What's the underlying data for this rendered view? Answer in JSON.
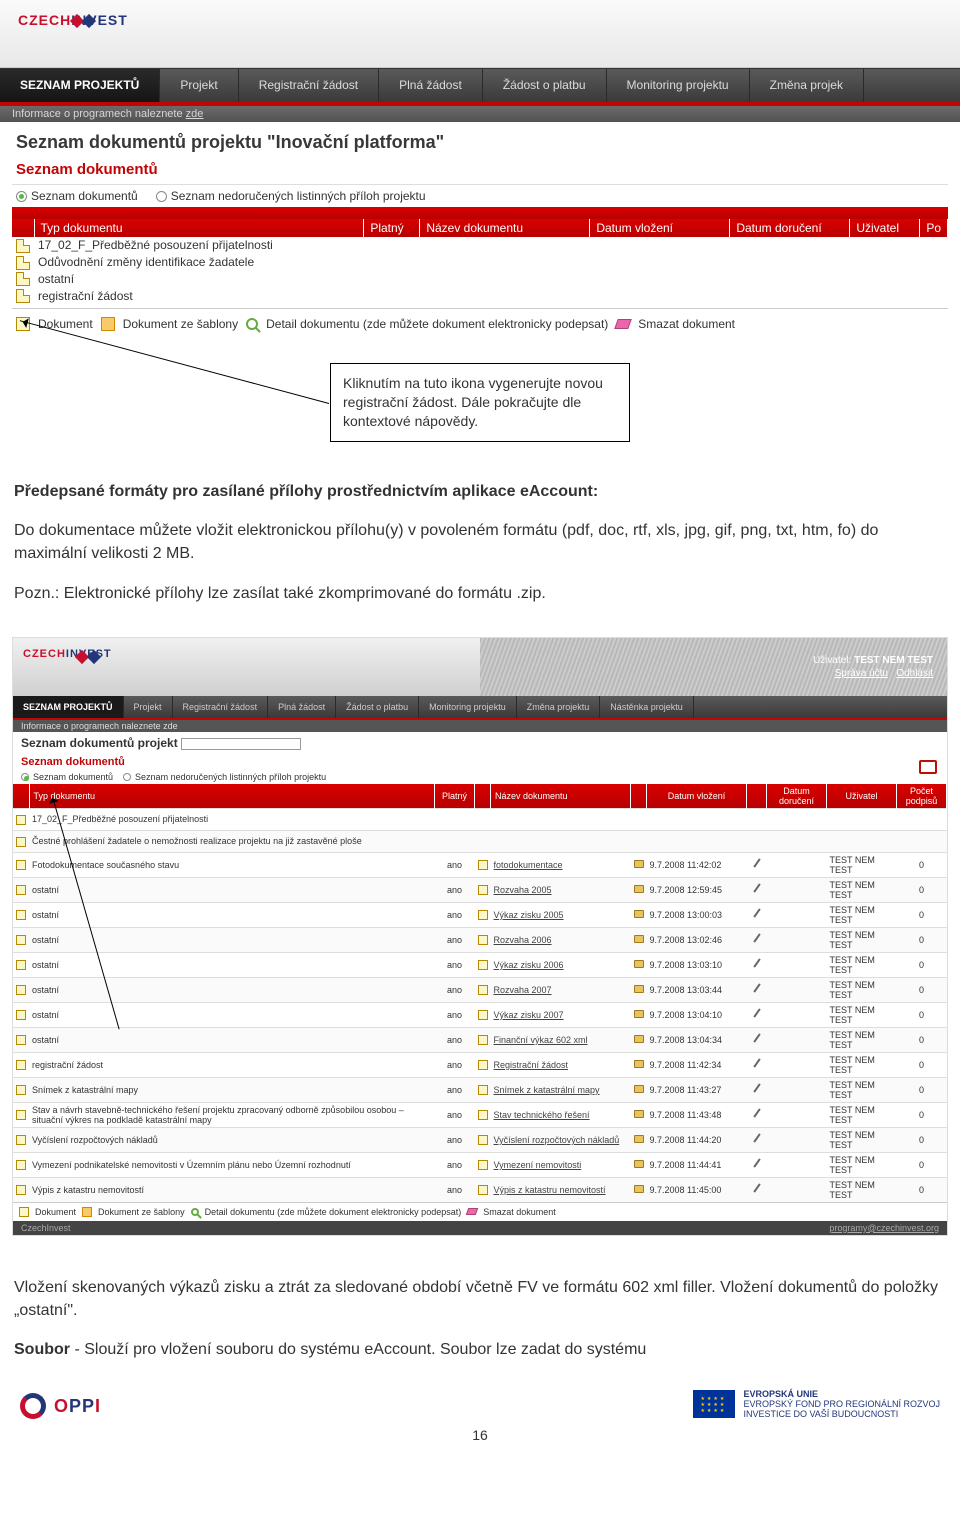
{
  "app1": {
    "brand_a": "CZECH",
    "brand_b": "INVEST",
    "menu": {
      "seznam": "SEZNAM PROJEKTŮ",
      "projekt": "Projekt",
      "registracni": "Registrační žádost",
      "plna": "Plná žádost",
      "platbu": "Žádost o platbu",
      "monitoring": "Monitoring projektu",
      "zmena": "Změna projek"
    },
    "infobar": "Informace o programech naleznete",
    "infobar_link": "zde",
    "title": "Seznam dokumentů projektu  \"Inovační platforma\"",
    "section": "Seznam dokumentů",
    "radio1": "Seznam dokumentů",
    "radio2": "Seznam nedoručených listinných příloh projektu",
    "th": {
      "typ": "Typ dokumentu",
      "platny": "Platný",
      "nazev": "Název dokumentu",
      "vlozeni": "Datum vložení",
      "doruceni": "Datum doručení",
      "uzivatel": "Uživatel",
      "po": "Po"
    },
    "rows": [
      "17_02_F_Předběžné posouzení přijatelnosti",
      "Odůvodnění změny identifikace žadatele",
      "ostatní",
      "registrační žádost"
    ],
    "actions": {
      "dokument": "Dokument",
      "sablona": "Dokument ze šablony",
      "detail": "Detail dokumentu (zde můžete dokument elektronicky podepsat)",
      "smazat": "Smazat dokument"
    }
  },
  "callout": "Kliknutím na tuto ikona vygenerujte novou registrační žádost. Dále pokračujte dle kontextové nápovědy.",
  "para1": "Předepsané formáty pro zasílané přílohy prostřednictvím aplikace eAccount:",
  "para2": "Do dokumentace můžete vložit elektronickou přílohu(y) v povoleném formátu (pdf, doc, rtf, xls, jpg, gif, png, txt, htm, fo) do maximální velikosti 2 MB.",
  "para3": "Pozn.: Elektronické přílohy lze zasílat také zkomprimované do formátu .zip.",
  "app2": {
    "user_label": "Uživatel:",
    "user_value": "TEST NEM TEST",
    "sprava": "Správa účtu",
    "odhlasit": "Odhlásit",
    "menu": {
      "seznam": "SEZNAM PROJEKTŮ",
      "projekt": "Projekt",
      "registracni": "Registrační žádost",
      "plna": "Plná žádost",
      "platbu": "Žádost o platbu",
      "monitoring": "Monitoring projektu",
      "zmena": "Změna projektu",
      "nastenka": "Nástěnka projektu"
    },
    "infobar": "Informace o programech naleznete zde",
    "title": "Seznam dokumentů projekt",
    "section": "Seznam dokumentů",
    "radio1": "Seznam dokumentů",
    "radio2": "Seznam nedoručených listinných příloh projektu",
    "th": {
      "typ": "Typ dokumentu",
      "platny": "Platný",
      "nazev": "Název dokumentu",
      "vlozeni": "Datum vložení",
      "doruceni": "Datum doručení",
      "uzivatel": "Uživatel",
      "podpisu": "Počet podpisů"
    },
    "rows": [
      {
        "typ": "17_02_F_Předběžné posouzení přijatelnosti",
        "platny": "",
        "nazev": "",
        "datum": "",
        "user": "",
        "pocet": ""
      },
      {
        "typ": "Čestné prohlášení žadatele o nemožnosti realizace projektu na již zastavěné ploše",
        "platny": "",
        "nazev": "",
        "datum": "",
        "user": "",
        "pocet": ""
      },
      {
        "typ": "Fotodokumentace současného stavu",
        "platny": "ano",
        "nazev": "fotodokumentace",
        "datum": "9.7.2008 11:42:02",
        "user": "TEST NEM TEST",
        "pocet": "0"
      },
      {
        "typ": "ostatní",
        "platny": "ano",
        "nazev": "Rozvaha 2005",
        "datum": "9.7.2008 12:59:45",
        "user": "TEST NEM TEST",
        "pocet": "0"
      },
      {
        "typ": "ostatní",
        "platny": "ano",
        "nazev": "Výkaz zisku 2005",
        "datum": "9.7.2008 13:00:03",
        "user": "TEST NEM TEST",
        "pocet": "0"
      },
      {
        "typ": "ostatní",
        "platny": "ano",
        "nazev": "Rozvaha 2006",
        "datum": "9.7.2008 13:02:46",
        "user": "TEST NEM TEST",
        "pocet": "0"
      },
      {
        "typ": "ostatní",
        "platny": "ano",
        "nazev": "Výkaz zisku 2006",
        "datum": "9.7.2008 13:03:10",
        "user": "TEST NEM TEST",
        "pocet": "0"
      },
      {
        "typ": "ostatní",
        "platny": "ano",
        "nazev": "Rozvaha 2007",
        "datum": "9.7.2008 13:03:44",
        "user": "TEST NEM TEST",
        "pocet": "0"
      },
      {
        "typ": "ostatní",
        "platny": "ano",
        "nazev": "Výkaz zisku 2007",
        "datum": "9.7.2008 13:04:10",
        "user": "TEST NEM TEST",
        "pocet": "0"
      },
      {
        "typ": "ostatní",
        "platny": "ano",
        "nazev": "Finanční výkaz 602 xml",
        "datum": "9.7.2008 13:04:34",
        "user": "TEST NEM TEST",
        "pocet": "0"
      },
      {
        "typ": "registrační žádost",
        "platny": "ano",
        "nazev": "Registrační žádost",
        "datum": "9.7.2008 11:42:34",
        "user": "TEST NEM TEST",
        "pocet": "0"
      },
      {
        "typ": "Snímek z katastrální mapy",
        "platny": "ano",
        "nazev": "Snímek z katastrální mapy",
        "datum": "9.7.2008 11:43:27",
        "user": "TEST NEM TEST",
        "pocet": "0"
      },
      {
        "typ": "Stav a návrh stavebně-technického řešení projektu zpracovaný odborně způsobilou osobou – situační výkres na podkladě katastrální mapy",
        "platny": "ano",
        "nazev": "Stav technického řešení",
        "datum": "9.7.2008 11:43:48",
        "user": "TEST NEM TEST",
        "pocet": "0"
      },
      {
        "typ": "Vyčíslení rozpočtových nákladů",
        "platny": "ano",
        "nazev": "Vyčíslení rozpočtových nákladů",
        "datum": "9.7.2008 11:44:20",
        "user": "TEST NEM TEST",
        "pocet": "0"
      },
      {
        "typ": "Vymezení podnikatelské nemovitosti v Územním plánu nebo Územní rozhodnutí",
        "platny": "ano",
        "nazev": "Vymezení nemovitosti",
        "datum": "9.7.2008 11:44:41",
        "user": "TEST NEM TEST",
        "pocet": "0"
      },
      {
        "typ": "Výpis z katastru nemovitostí",
        "platny": "ano",
        "nazev": "Výpis z katastru nemovitostí",
        "datum": "9.7.2008 11:45:00",
        "user": "TEST NEM TEST",
        "pocet": "0"
      }
    ],
    "actions": {
      "dokument": "Dokument",
      "sablona": "Dokument ze šablony",
      "detail": "Detail dokumentu (zde můžete dokument elektronicky podepsat)",
      "smazat": "Smazat dokument"
    },
    "footer_left": "CzechInvest",
    "footer_right": "programy@czechinvest.org"
  },
  "bottom1": "Vložení skenovaných výkazů zisku a ztrát za sledované období včetně FV ve formátu 602 xml filler. Vložení dokumentů do položky „ostatní\".",
  "bottom2a": "Soubor",
  "bottom2b": " - Slouží pro vložení souboru do systému eAccount. Soubor lze zadat do systému",
  "oppi_a": "O",
  "oppi_b": "PP",
  "oppi_c": "I",
  "eu1": "EVROPSKÁ UNIE",
  "eu2": "EVROPSKÝ FOND PRO REGIONÁLNÍ ROZVOJ",
  "eu3": "INVESTICE DO VAŠÍ BUDOUCNOSTI",
  "pagenum": "16"
}
